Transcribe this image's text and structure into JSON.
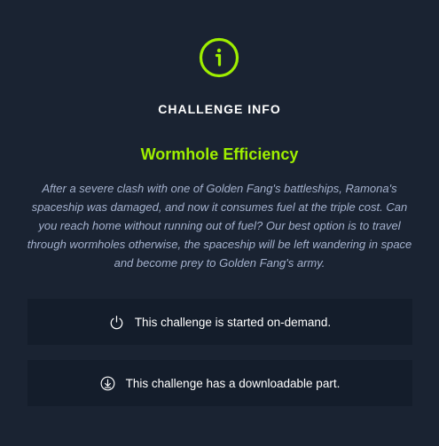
{
  "header": {
    "icon": "info-circle-icon",
    "title": "CHALLENGE INFO"
  },
  "challenge": {
    "name": "Wormhole Efficiency",
    "description": "After a severe clash with one of Golden Fang's battleships, Ramona's spaceship was damaged, and now it consumes fuel at the triple cost. Can you reach home without running out of fuel? Our best option is to travel through wormholes otherwise, the spaceship will be left wandering in space and become prey to Golden Fang's army."
  },
  "cards": [
    {
      "icon": "power-icon",
      "text": "This challenge is started on-demand."
    },
    {
      "icon": "download-icon",
      "text": "This challenge has a downloadable part."
    }
  ],
  "colors": {
    "background": "#1a2332",
    "accent": "#9fef00",
    "card_background": "#141d2b",
    "description_text": "#a4b1cd"
  }
}
